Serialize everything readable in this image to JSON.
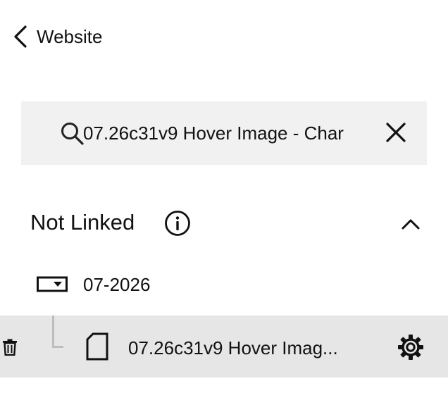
{
  "nav": {
    "back_label": "Website",
    "back_icon": "chevron-left-icon"
  },
  "search": {
    "value": "07.26c31v9 Hover Image - Char",
    "icon": "search-icon",
    "clear_icon": "close-icon"
  },
  "section": {
    "title": "Not Linked",
    "info_icon": "info-icon",
    "toggle_icon": "chevron-up-icon",
    "expanded": true
  },
  "folder": {
    "label": "07-2026",
    "icon": "folder-dropdown-icon"
  },
  "page_item": {
    "label": "07.26c31v9 Hover Imag...",
    "icon": "page-icon",
    "delete_icon": "trash-icon",
    "settings_icon": "gear-icon",
    "selected": true
  },
  "colors": {
    "text": "#111111",
    "search_background": "#f1f1f1",
    "selected_row_background": "#e6e6e6",
    "tree_line": "#bdbdbd"
  }
}
